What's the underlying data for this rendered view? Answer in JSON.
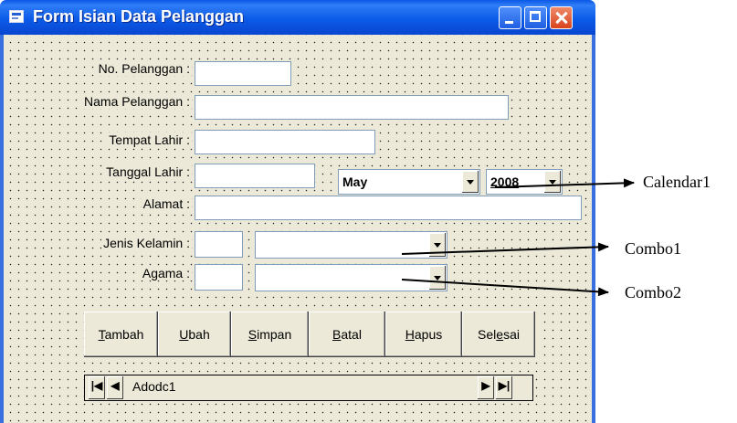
{
  "window": {
    "title": "Form Isian Data Pelanggan"
  },
  "labels": {
    "no_pelanggan": "No. Pelanggan :",
    "nama_pelanggan": "Nama  Pelanggan :",
    "tempat_lahir": "Tempat Lahir :",
    "tanggal_lahir": "Tanggal Lahir :",
    "alamat": "Alamat :",
    "jenis_kelamin": "Jenis Kelamin :",
    "agama": "Agama :"
  },
  "date": {
    "month": "May",
    "year": "2008"
  },
  "buttons": {
    "tambah": {
      "accel": "T",
      "rest": "ambah"
    },
    "ubah": {
      "accel": "U",
      "rest": "bah"
    },
    "simpan": {
      "accel": "S",
      "rest": "impan"
    },
    "batal": {
      "accel": "B",
      "rest": "atal"
    },
    "hapus": {
      "accel": "H",
      "rest": "apus"
    },
    "selesai": {
      "pre": "Sel",
      "accel": "e",
      "rest": "sai"
    }
  },
  "adodc": {
    "caption": "Adodc1"
  },
  "annotations": {
    "calendar": "Calendar1",
    "combo1": "Combo1",
    "combo2": "Combo2"
  }
}
